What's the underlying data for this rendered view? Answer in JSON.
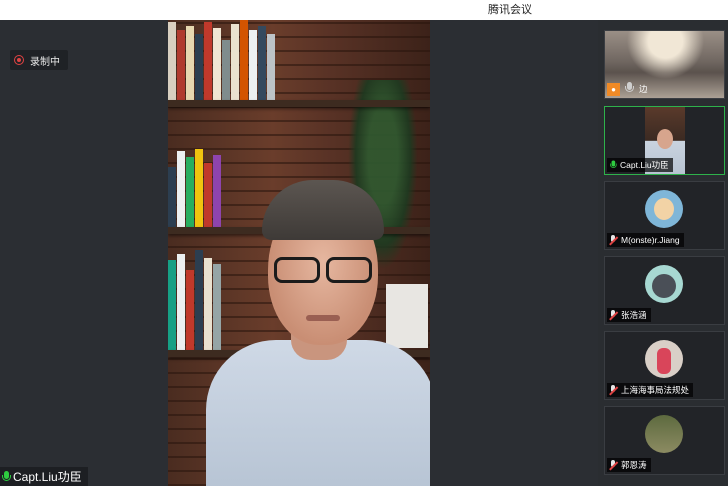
{
  "window": {
    "title": "腾讯会议"
  },
  "recording": {
    "label": "录制中"
  },
  "main_speaker": {
    "name": "Capt.Liu功臣"
  },
  "participants": [
    {
      "name": "边",
      "kind": "room",
      "mic": "on"
    },
    {
      "name": "Capt.Liu功臣",
      "kind": "video",
      "mic": "on",
      "active": true
    },
    {
      "name": "M(onste)r.Jiang",
      "kind": "avatar",
      "mic": "off"
    },
    {
      "name": "张浩涵",
      "kind": "avatar",
      "mic": "off"
    },
    {
      "name": "上海海事局法规处",
      "kind": "avatar",
      "mic": "off"
    },
    {
      "name": "郭恩涛",
      "kind": "avatar",
      "mic": "off"
    }
  ],
  "colors": {
    "active_border": "#2eb24b",
    "record_red": "#e04343",
    "mic_green": "#2ecc40",
    "user_badge": "#f08a26"
  },
  "icons": {
    "record": "record-icon",
    "mic": "microphone-icon",
    "mic_muted": "microphone-muted-icon",
    "user": "user-icon"
  }
}
